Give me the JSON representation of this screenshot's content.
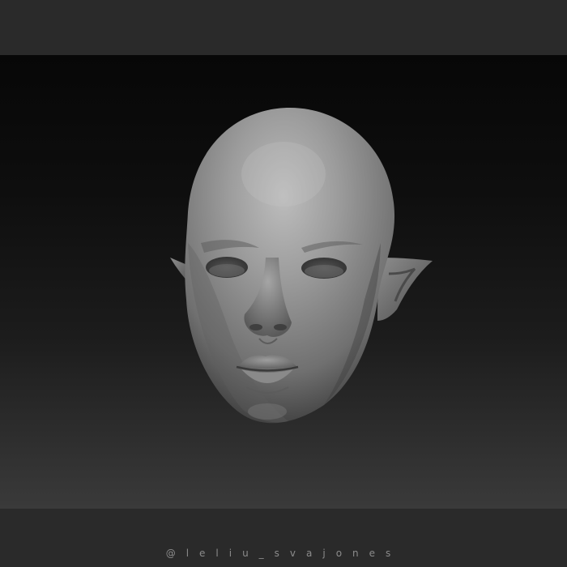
{
  "watermark": {
    "text": "@leliu_svajones"
  },
  "colors": {
    "band": "#2a2a2a",
    "background_top": "#070707",
    "background_bottom": "#3a3a3a",
    "sculpt_highlight": "#b9b9b9",
    "sculpt_shadow": "#3c3c3c",
    "watermark": "#8c8c8c"
  }
}
